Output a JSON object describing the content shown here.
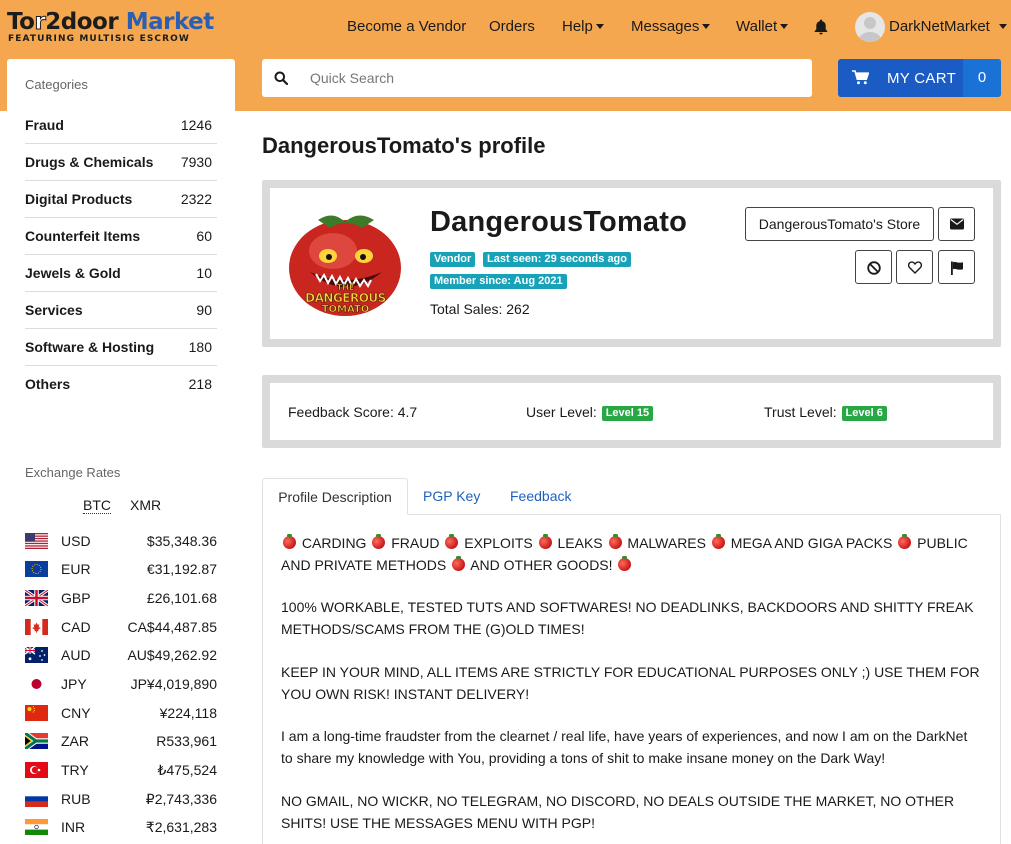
{
  "brand": {
    "logo_line1_a": "To",
    "logo_line1_b": "r",
    "logo_line1_c": "2door",
    "logo_line1_d": " Market",
    "logo_line2": "FEATURING MULTISIG ESCROW"
  },
  "nav": {
    "become_vendor": "Become a Vendor",
    "orders": "Orders",
    "help": "Help",
    "messages": "Messages",
    "wallet": "Wallet",
    "username": "DarkNetMarket"
  },
  "search": {
    "placeholder": "Quick Search"
  },
  "cart": {
    "label": "MY CART",
    "count": "0"
  },
  "categories": {
    "title": "Categories",
    "items": [
      {
        "name": "Fraud",
        "count": "1246"
      },
      {
        "name": "Drugs & Chemicals",
        "count": "7930"
      },
      {
        "name": "Digital Products",
        "count": "2322"
      },
      {
        "name": "Counterfeit Items",
        "count": "60"
      },
      {
        "name": "Jewels & Gold",
        "count": "10"
      },
      {
        "name": "Services",
        "count": "90"
      },
      {
        "name": "Software & Hosting",
        "count": "180"
      },
      {
        "name": "Others",
        "count": "218"
      }
    ]
  },
  "exchange": {
    "title": "Exchange Rates",
    "tabs": [
      "BTC",
      "XMR"
    ],
    "rates": [
      {
        "currency": "USD",
        "value": "$35,348.36",
        "flag": "us-flag"
      },
      {
        "currency": "EUR",
        "value": "€31,192.87",
        "flag": "eu-flag"
      },
      {
        "currency": "GBP",
        "value": "£26,101.68",
        "flag": "uk-flag"
      },
      {
        "currency": "CAD",
        "value": "CA$44,487.85",
        "flag": "ca-flag"
      },
      {
        "currency": "AUD",
        "value": "AU$49,262.92",
        "flag": "au-flag"
      },
      {
        "currency": "JPY",
        "value": "JP¥4,019,890",
        "flag": "jp-flag"
      },
      {
        "currency": "CNY",
        "value": "¥224,118",
        "flag": "cn-flag"
      },
      {
        "currency": "ZAR",
        "value": "R533,961",
        "flag": "za-flag"
      },
      {
        "currency": "TRY",
        "value": "₺475,524",
        "flag": "tr-flag"
      },
      {
        "currency": "RUB",
        "value": "₽2,743,336",
        "flag": "ru-flag"
      },
      {
        "currency": "INR",
        "value": "₹2,631,283",
        "flag": "in-flag"
      }
    ]
  },
  "profile": {
    "page_title": "DangerousTomato's profile",
    "vendor_name": "DangerousTomato",
    "avatar_text_1": "THE",
    "avatar_text_2": "DANGEROUS",
    "avatar_text_3": "TOMATO",
    "badge_vendor": "Vendor",
    "badge_last_seen": "Last seen: 29 seconds ago",
    "badge_member_since": "Member since: Aug 2021",
    "total_sales": "Total Sales: 262",
    "store_button": "DangerousTomato's Store"
  },
  "feedback": {
    "score": "Feedback Score: 4.7",
    "user_level_label": "User Level:",
    "user_level_badge": "Level 15",
    "trust_level_label": "Trust Level:",
    "trust_level_badge": "Level 6"
  },
  "tabs": {
    "profile_description": "Profile Description",
    "pgp_key": "PGP Key",
    "feedback": "Feedback"
  },
  "description": {
    "p1_parts": [
      "CARDING",
      "FRAUD",
      "EXPLOITS",
      "LEAKS",
      "MALWARES",
      "MEGA AND GIGA PACKS",
      "PUBLIC AND PRIVATE METHODS",
      "AND OTHER GOODS!"
    ],
    "p2": "100% WORKABLE, TESTED TUTS AND SOFTWARES! NO DEADLINKS, BACKDOORS AND SHITTY FREAK METHODS/SCAMS FROM THE (G)OLD TIMES!",
    "p3": "KEEP IN YOUR MIND, ALL ITEMS ARE STRICTLY FOR EDUCATIONAL PURPOSES ONLY ;) USE THEM FOR YOU OWN RISK! INSTANT DELIVERY!",
    "p4": "I am a long-time fraudster from the clearnet / real life, have years of experiences, and now I am on the DarkNet to share my knowledge with You, providing a tons of shit to make insane money on the Dark Way!",
    "p5": "NO GMAIL, NO WICKR, NO TELEGRAM, NO DISCORD, NO DEALS OUTSIDE THE MARKET, NO OTHER SHITS! USE THE MESSAGES MENU WITH PGP!"
  }
}
